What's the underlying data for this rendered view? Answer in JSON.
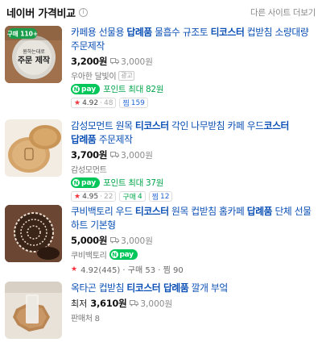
{
  "header": {
    "title": "네이버 가격비교",
    "info_icon": "i",
    "more": "다른 사이트 더보기"
  },
  "items": [
    {
      "title_parts": [
        "카페용 선물용 ",
        "답례품",
        " 물흡수 규조토 ",
        "티코스터",
        " 컵받침 소량대량 주문제작"
      ],
      "price": "3,200원",
      "shipping": "3,000원",
      "seller": "우아한 달빛이",
      "ad_label": "광고",
      "npay": "pay",
      "point": "포인트 최대 82원",
      "rating": "4.92",
      "review_count": "48",
      "zzim_label": "찜",
      "zzim_count": "159",
      "thumb_badge": "구매 110+",
      "thumb_text_small": "원하는대로",
      "thumb_text_big": "주문 제작"
    },
    {
      "title_parts": [
        "감성모먼트 원목 ",
        "티코스터",
        " 각인 나무받침 카페 우드",
        "코스터 답례품",
        " 주문제작"
      ],
      "price": "3,700원",
      "shipping": "3,000원",
      "seller": "감성모먼트",
      "npay": "pay",
      "point": "포인트 최대 37원",
      "rating": "4.95",
      "review_count": "22",
      "buy_label": "구매",
      "buy_count": "4",
      "zzim_label": "찜",
      "zzim_count": "12"
    },
    {
      "title_parts": [
        "쿠비백토리 우드 ",
        "티코스터",
        " 원목 컵받침 홈카페 ",
        "답례품",
        " 단체 선물 하트 기본형"
      ],
      "price": "5,000원",
      "shipping": "3,000원",
      "seller": "쿠비백토리",
      "npay": "pay",
      "meta": "4.92(445) · 구매 53 · 찜 90",
      "rating": "4.92"
    },
    {
      "title_parts": [
        "옥타곤 컵받침 ",
        "티코스터 답례품",
        " 깔개 부엌"
      ],
      "price_prefix": "최저",
      "price": "3,610원",
      "shipping": "3,000원",
      "sellers": "판매처 8"
    }
  ]
}
